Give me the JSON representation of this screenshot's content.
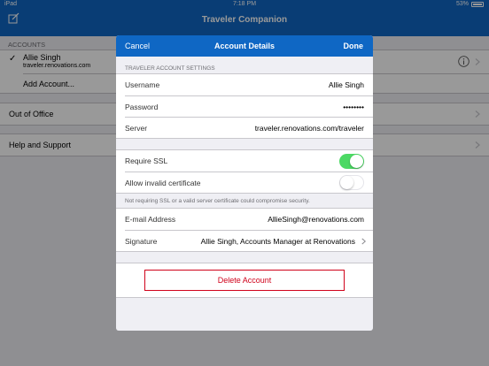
{
  "status": {
    "carrier": "iPad",
    "time": "7:18 PM",
    "battery": "53%"
  },
  "app": {
    "title": "Traveler Companion"
  },
  "accounts": {
    "header": "ACCOUNTS",
    "name": "Allie Singh",
    "server": "traveler.renovations.com",
    "add_label": "Add Account..."
  },
  "menu": {
    "out_of_office": "Out of Office",
    "help": "Help and Support"
  },
  "modal": {
    "cancel": "Cancel",
    "title": "Account Details",
    "done": "Done",
    "settings_header": "TRAVELER ACCOUNT SETTINGS",
    "username_label": "Username",
    "username_value": "Allie Singh",
    "password_label": "Password",
    "password_value": "••••••••",
    "server_label": "Server",
    "server_value": "traveler.renovations.com/traveler",
    "ssl_label": "Require SSL",
    "ssl_on": true,
    "invalid_cert_label": "Allow invalid certificate",
    "invalid_cert_on": false,
    "ssl_note": "Not requiring SSL or a valid server certificate could compromise security.",
    "email_label": "E-mail Address",
    "email_value": "AllieSingh@renovations.com",
    "signature_label": "Signature",
    "signature_value": "Allie Singh, Accounts Manager at Renovations",
    "delete_label": "Delete Account"
  },
  "colors": {
    "brand": "#0f67c4",
    "toggle_on": "#4cd964",
    "danger": "#d0021b"
  }
}
